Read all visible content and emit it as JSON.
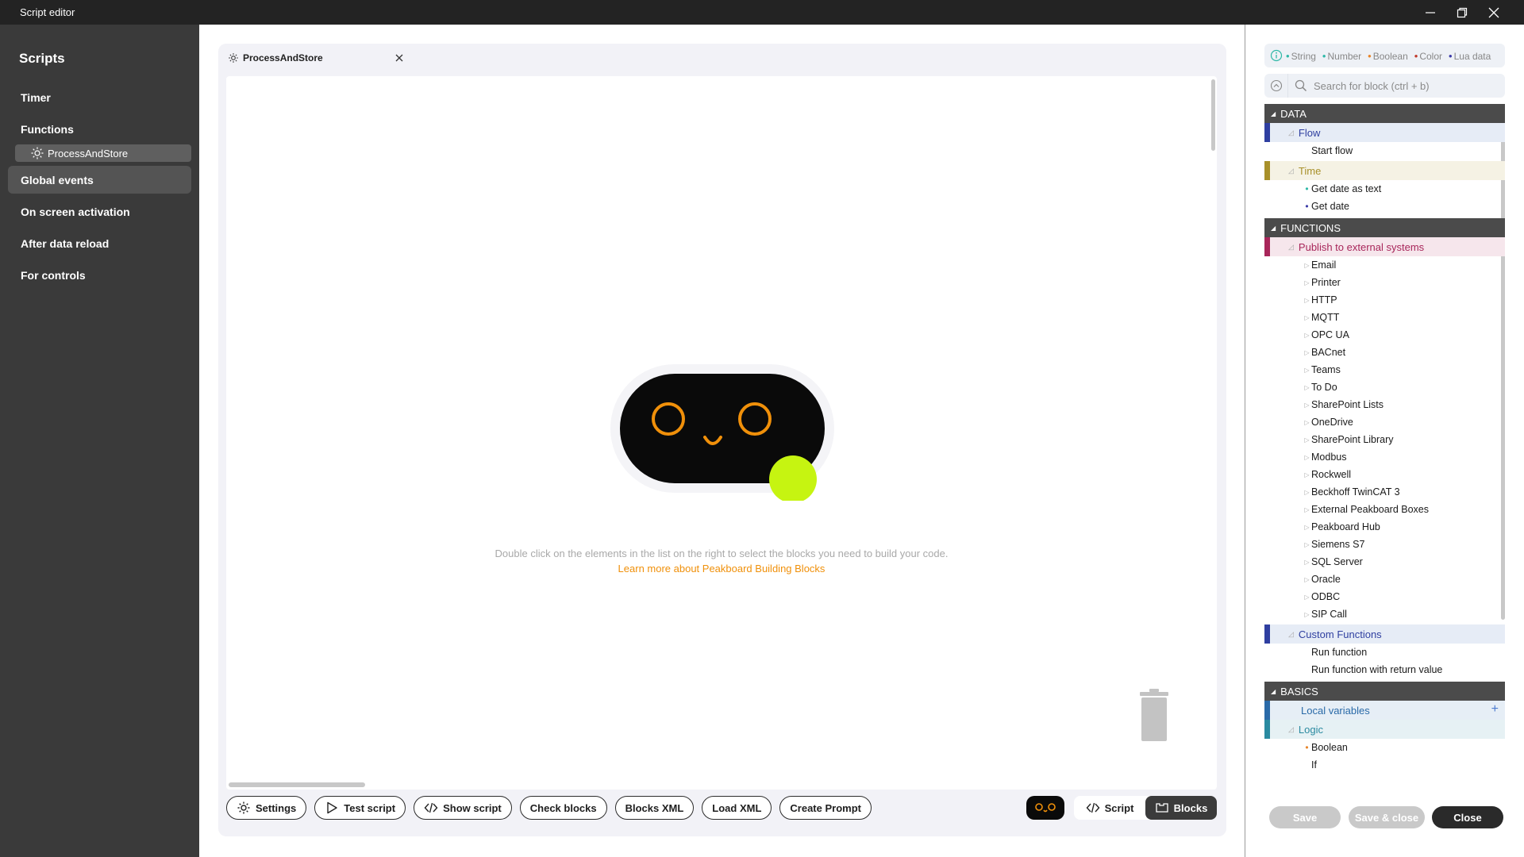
{
  "window": {
    "title": "Script editor"
  },
  "sidebar": {
    "heading": "Scripts",
    "items": [
      {
        "label": "Timer"
      },
      {
        "label": "Functions"
      },
      {
        "label": "Global events"
      },
      {
        "label": "On screen activation"
      },
      {
        "label": "After data reload"
      },
      {
        "label": "For controls"
      }
    ],
    "function_item": "ProcessAndStore",
    "active_item": "Global events"
  },
  "editor": {
    "tab_label": "ProcessAndStore",
    "hint": "Double click on the elements in the list on the right to select the blocks you need to build your code.",
    "learn_link": "Learn more about Peakboard Building Blocks"
  },
  "toolbar": {
    "settings": "Settings",
    "test_script": "Test script",
    "show_script": "Show script",
    "check_blocks": "Check blocks",
    "blocks_xml": "Blocks XML",
    "load_xml": "Load XML",
    "create_prompt": "Create Prompt",
    "view_script": "Script",
    "view_blocks": "Blocks",
    "active_view": "Blocks"
  },
  "legend": {
    "items": [
      {
        "label": "String",
        "color": "#2fb8a7"
      },
      {
        "label": "Number",
        "color": "#2fb8a7"
      },
      {
        "label": "Boolean",
        "color": "#e8852a"
      },
      {
        "label": "Color",
        "color": "#c0392b"
      },
      {
        "label": "Lua data",
        "color": "#3a3aa8"
      }
    ]
  },
  "search": {
    "placeholder": "Search for block (ctrl + b)"
  },
  "tree": {
    "data": {
      "label": "DATA",
      "flow": {
        "label": "Flow",
        "color": "#2f3fa0",
        "bg": "#e6ecf6",
        "items": [
          "Start flow"
        ]
      },
      "time": {
        "label": "Time",
        "color": "#a8902a",
        "bg": "#f5f2e4",
        "items": [
          "Get date as text",
          "Get date"
        ],
        "markers": [
          "#2fb8a7",
          "#3a3aa8"
        ]
      }
    },
    "functions": {
      "label": "FUNCTIONS",
      "publish": {
        "label": "Publish to external systems",
        "color": "#a8265a",
        "bg": "#f6e6ec",
        "items": [
          "Email",
          "Printer",
          "HTTP",
          "MQTT",
          "OPC UA",
          "BACnet",
          "Teams",
          "To Do",
          "SharePoint Lists",
          "OneDrive",
          "SharePoint Library",
          "Modbus",
          "Rockwell",
          "Beckhoff TwinCAT 3",
          "External Peakboard Boxes",
          "Peakboard Hub",
          "Siemens S7",
          "SQL Server",
          "Oracle",
          "ODBC",
          "SIP Call"
        ]
      },
      "custom": {
        "label": "Custom Functions",
        "color": "#2f3fa0",
        "bg": "#e6ecf6",
        "items": [
          "Run function",
          "Run function with return value"
        ]
      }
    },
    "basics": {
      "label": "BASICS",
      "local_vars": {
        "label": "Local variables",
        "color": "#2a6aa8",
        "bg": "#e6eef6"
      },
      "logic": {
        "label": "Logic",
        "color": "#2a8aa0",
        "bg": "#e6f1f4",
        "items": [
          "Boolean",
          "If"
        ],
        "marker": "#e8852a"
      }
    }
  },
  "actions": {
    "save": "Save",
    "save_close": "Save & close",
    "close": "Close"
  }
}
